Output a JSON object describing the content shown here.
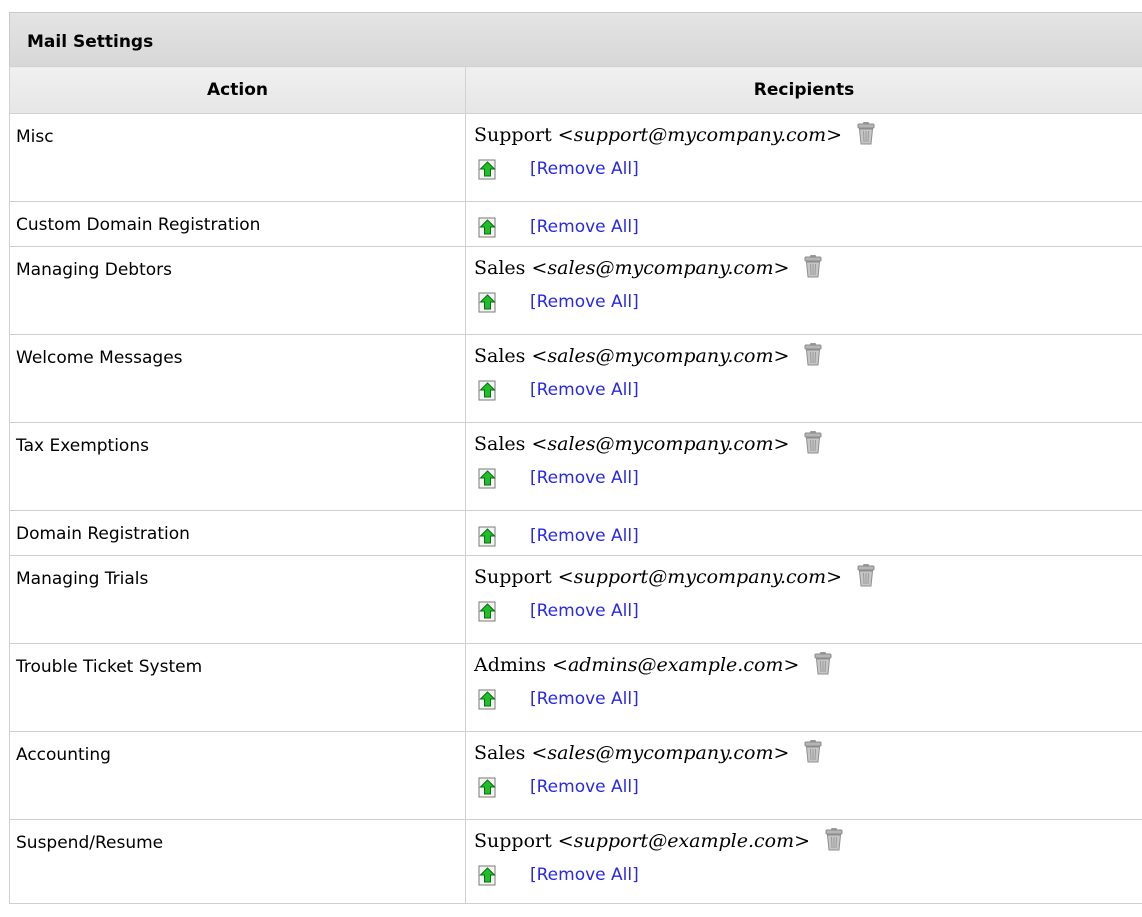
{
  "panel": {
    "title": "Mail Settings"
  },
  "table": {
    "columns": [
      "Action",
      "Recipients"
    ],
    "rows": [
      {
        "action": "Misc",
        "recipient": {
          "name": "Support",
          "email": "support@mycompany.com"
        }
      },
      {
        "action": "Custom Domain Registration",
        "recipient": null
      },
      {
        "action": "Managing Debtors",
        "recipient": {
          "name": "Sales",
          "email": "sales@mycompany.com"
        }
      },
      {
        "action": "Welcome Messages",
        "recipient": {
          "name": "Sales",
          "email": "sales@mycompany.com"
        }
      },
      {
        "action": "Tax Exemptions",
        "recipient": {
          "name": "Sales",
          "email": "sales@mycompany.com"
        }
      },
      {
        "action": "Domain Registration",
        "recipient": null
      },
      {
        "action": "Managing Trials",
        "recipient": {
          "name": "Support",
          "email": "support@mycompany.com"
        }
      },
      {
        "action": "Trouble Ticket System",
        "recipient": {
          "name": "Admins",
          "email": "admins@example.com"
        }
      },
      {
        "action": "Accounting",
        "recipient": {
          "name": "Sales",
          "email": "sales@mycompany.com"
        }
      },
      {
        "action": "Suspend/Resume",
        "recipient": {
          "name": "Support",
          "email": "support@example.com"
        }
      }
    ]
  },
  "labels": {
    "remove_all": "[Remove All]",
    "lt": "<",
    "gt": ">"
  },
  "icons": {
    "add": "add-recipient-icon",
    "delete": "trash-icon"
  },
  "colors": {
    "link": "#2828e8",
    "add_icon_green": "#1fbf2a"
  }
}
